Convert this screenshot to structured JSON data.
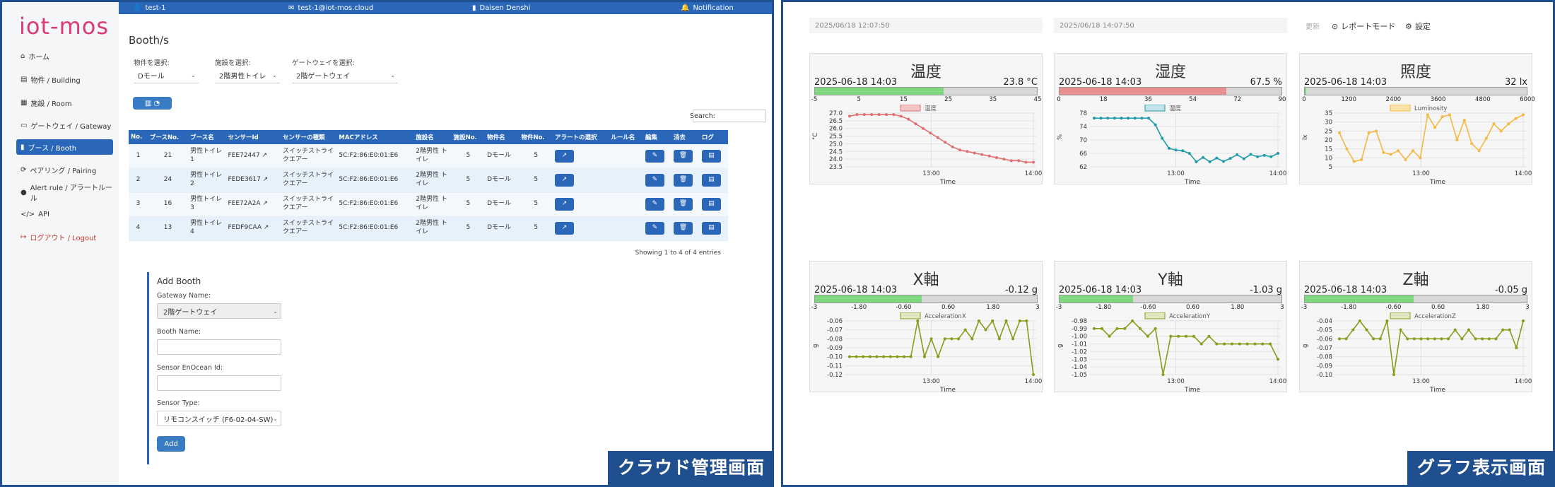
{
  "left_panel": {
    "caption": "クラウド管理画面",
    "logo": "iot-mos",
    "topbar": {
      "tenant": "test-1",
      "email": "test-1@iot-mos.cloud",
      "company": "Daisen Denshi",
      "notification": "Notification"
    },
    "nav": [
      {
        "icon": "home-icon",
        "glyph": "⌂",
        "label": "ホーム"
      },
      {
        "icon": "building-icon",
        "glyph": "▤",
        "label": "物件 / Building"
      },
      {
        "icon": "room-icon",
        "glyph": "▦",
        "label": "施設 / Room"
      },
      {
        "icon": "gateway-icon",
        "glyph": "▭",
        "label": "ゲートウェイ / Gateway"
      },
      {
        "icon": "booth-icon",
        "glyph": "▮",
        "label": "ブース / Booth"
      },
      {
        "icon": "pairing-icon",
        "glyph": "⟳",
        "label": "ペアリング / Pairing"
      },
      {
        "icon": "alert-icon",
        "glyph": "●",
        "label": "Alert rule / アラートルール"
      },
      {
        "icon": "code-icon",
        "glyph": "</>",
        "label": "API"
      },
      {
        "icon": "logout-icon",
        "glyph": "↦",
        "label": "ログアウト / Logout"
      }
    ],
    "active_nav": 4,
    "page_title": "Booth/s",
    "filters": [
      {
        "label": "物件を選択:",
        "value": "Dモール"
      },
      {
        "label": "施設を選択:",
        "value": "2階男性トイレ"
      },
      {
        "label": "ゲートウェイを選択:",
        "value": "2階ゲートウェイ"
      }
    ],
    "view_toggle_label": "▥ ◔",
    "search_label": "Search:",
    "columns": [
      "No.",
      "ブースNo.",
      "ブース名",
      "センサーId",
      "センサーの種類",
      "MACアドレス",
      "施設名",
      "施設No.",
      "物件名",
      "物件No.",
      "アラートの選択",
      "ルール名",
      "編集",
      "消去",
      "ログ"
    ],
    "rows": [
      {
        "no": "1",
        "booth_no": "21",
        "booth_name": "男性トイレ 1",
        "sensor_id": "FEE72447",
        "sensor_type": "スイッチストライクエアー",
        "mac": "5C:F2:86:E0:01:E6",
        "room": "2階男性 トイレ",
        "room_no": "5",
        "building": "Dモール",
        "building_no": "5",
        "rule": ""
      },
      {
        "no": "2",
        "booth_no": "24",
        "booth_name": "男性トイレ 2",
        "sensor_id": "FEDE3617",
        "sensor_type": "スイッチストライクエアー",
        "mac": "5C:F2:86:E0:01:E6",
        "room": "2階男性 トイレ",
        "room_no": "5",
        "building": "Dモール",
        "building_no": "5",
        "rule": ""
      },
      {
        "no": "3",
        "booth_no": "16",
        "booth_name": "男性トイレ 3",
        "sensor_id": "FEE72A2A",
        "sensor_type": "スイッチストライクエアー",
        "mac": "5C:F2:86:E0:01:E6",
        "room": "2階男性 トイレ",
        "room_no": "5",
        "building": "Dモール",
        "building_no": "5",
        "rule": ""
      },
      {
        "no": "4",
        "booth_no": "13",
        "booth_name": "男性トイレ 4",
        "sensor_id": "FEDF9CAA",
        "sensor_type": "スイッチストライクエアー",
        "mac": "5C:F2:86:E0:01:E6",
        "room": "2階男性 トイレ",
        "room_no": "5",
        "building": "Dモール",
        "building_no": "5",
        "rule": ""
      }
    ],
    "showing": "Showing 1 to 4 of 4 entries",
    "add_booth": {
      "title": "Add Booth",
      "gateway_label": "Gateway Name:",
      "gateway_value": "2階ゲートウェイ",
      "booth_label": "Booth Name:",
      "booth_value": "",
      "enocean_label": "Sensor EnOcean Id:",
      "enocean_value": "",
      "type_label": "Sensor Type:",
      "type_value": "リモコンスイッチ (F6-02-04-SW)",
      "add_button": "Add"
    }
  },
  "right_panel": {
    "caption": "グラフ表示画面",
    "start_date": "2025/06/18 12:07:50",
    "end_date": "2025/06/18 14:07:50",
    "update_label": "更新",
    "report_mode": "レポートモード",
    "settings": "設定",
    "x_axis_title": "Time",
    "colors": {
      "green": "#7fd87f",
      "red": "#e8908f",
      "temp_line": "#e07070",
      "hum_line": "#1f9aa8",
      "lux_line": "#f5b942",
      "acc_line": "#8a9a1a"
    },
    "cards": [
      {
        "title": "温度",
        "timestamp": "2025-06-18 14:03",
        "value": "23.8 °C",
        "level": 0.58,
        "bar_color": "#7fd87f",
        "gauge_ticks": [
          "-5",
          "5",
          "15",
          "25",
          "35",
          "45"
        ],
        "legend": "温度",
        "ylabel": "°C",
        "y_ticks": [
          "27.0",
          "26.5",
          "26.0",
          "25.5",
          "25.0",
          "24.5",
          "24.0",
          "23.5"
        ],
        "ymin": 23.5,
        "ymax": 27.0,
        "x_ticks": [
          "13:00",
          "14:00"
        ],
        "line_color": "#e07070",
        "legend_fill": "#f4c5c5",
        "series": [
          26.8,
          26.9,
          26.9,
          26.9,
          26.9,
          26.9,
          26.9,
          26.8,
          26.6,
          26.3,
          26.0,
          25.7,
          25.4,
          25.1,
          24.8,
          24.6,
          24.5,
          24.4,
          24.3,
          24.2,
          24.1,
          24.0,
          23.9,
          23.9,
          23.8,
          23.8
        ]
      },
      {
        "title": "湿度",
        "timestamp": "2025-06-18 14:03",
        "value": "67.5 %",
        "level": 0.75,
        "bar_color": "#e8908f",
        "gauge_ticks": [
          "0",
          "18",
          "36",
          "54",
          "72",
          "90"
        ],
        "legend": "湿度",
        "ylabel": "%",
        "y_ticks": [
          "78",
          "74",
          "70",
          "66",
          "62"
        ],
        "ymin": 62,
        "ymax": 78,
        "x_ticks": [
          "13:00",
          "14:00"
        ],
        "line_color": "#1f9aa8",
        "legend_fill": "#c5e5ea",
        "series": [
          76.5,
          76.5,
          76.5,
          76.5,
          76.5,
          76.5,
          76.5,
          76.5,
          76.5,
          74.5,
          70.5,
          67.5,
          67,
          66.8,
          66.0,
          63.5,
          64.8,
          63.5,
          64.6,
          63.6,
          64.5,
          65.6,
          64.4,
          65.7,
          65.0,
          65.4,
          65.0,
          66.0
        ]
      },
      {
        "title": "照度",
        "timestamp": "2025-06-18 14:03",
        "value": "32 lx",
        "level": 0.005,
        "bar_color": "#7fd87f",
        "gauge_ticks": [
          "0",
          "1200",
          "2400",
          "3600",
          "4800",
          "6000"
        ],
        "legend": "Luminosity",
        "ylabel": "lx",
        "y_ticks": [
          "35",
          "30",
          "25",
          "20",
          "15",
          "10",
          "5"
        ],
        "ymin": 5,
        "ymax": 35,
        "x_ticks": [
          "13:00",
          "14:00"
        ],
        "line_color": "#f5b942",
        "legend_fill": "#fbe2a8",
        "series": [
          24,
          15,
          8,
          9,
          24,
          25,
          13,
          12,
          14,
          9,
          14,
          10,
          34,
          27,
          33,
          34,
          20,
          31,
          18,
          14,
          21,
          29,
          25,
          29,
          32,
          34
        ]
      },
      {
        "title": "X軸",
        "timestamp": "2025-06-18 14:03",
        "value": "-0.12 g",
        "level": 0.48,
        "bar_color": "#7fd87f",
        "gauge_ticks": [
          "-3",
          "-1.80",
          "-0.60",
          "0.60",
          "1.80",
          "3"
        ],
        "legend": "AccelerationX",
        "ylabel": "g",
        "y_ticks": [
          "-0.06",
          "-0.07",
          "-0.08",
          "-0.09",
          "-0.10",
          "-0.11",
          "-0.12"
        ],
        "ymin": -0.12,
        "ymax": -0.06,
        "x_ticks": [
          "13:00",
          "14:00"
        ],
        "line_color": "#8a9a1a",
        "legend_fill": "#e2e6c3",
        "series": [
          -0.1,
          -0.1,
          -0.1,
          -0.1,
          -0.1,
          -0.1,
          -0.1,
          -0.1,
          -0.1,
          -0.1,
          -0.06,
          -0.1,
          -0.08,
          -0.1,
          -0.08,
          -0.08,
          -0.08,
          -0.07,
          -0.08,
          -0.06,
          -0.07,
          -0.06,
          -0.08,
          -0.06,
          -0.08,
          -0.06,
          -0.06,
          -0.12
        ]
      },
      {
        "title": "Y軸",
        "timestamp": "2025-06-18 14:03",
        "value": "-1.03 g",
        "level": 0.33,
        "bar_color": "#7fd87f",
        "gauge_ticks": [
          "-3",
          "-1.80",
          "-0.60",
          "0.60",
          "1.80",
          "3"
        ],
        "legend": "AccelerationY",
        "ylabel": "g",
        "y_ticks": [
          "-0.98",
          "-0.99",
          "-1.00",
          "-1.01",
          "-1.02",
          "-1.03",
          "-1.04",
          "-1.05"
        ],
        "ymin": -1.05,
        "ymax": -0.98,
        "x_ticks": [
          "13:00",
          "14:00"
        ],
        "line_color": "#8a9a1a",
        "legend_fill": "#e2e6c3",
        "series": [
          -0.99,
          -0.99,
          -1.0,
          -0.99,
          -0.99,
          -0.98,
          -0.99,
          -1.0,
          -0.99,
          -1.05,
          -1.0,
          -1.0,
          -1.0,
          -1.0,
          -1.01,
          -1.0,
          -1.01,
          -1.01,
          -1.01,
          -1.01,
          -1.01,
          -1.01,
          -1.01,
          -1.01,
          -1.03
        ]
      },
      {
        "title": "Z軸",
        "timestamp": "2025-06-18 14:03",
        "value": "-0.05 g",
        "level": 0.49,
        "bar_color": "#7fd87f",
        "gauge_ticks": [
          "-3",
          "-1.80",
          "-0.60",
          "0.60",
          "1.80",
          "3"
        ],
        "legend": "AccelerationZ",
        "ylabel": "g",
        "y_ticks": [
          "-0.04",
          "-0.05",
          "-0.06",
          "-0.07",
          "-0.08",
          "-0.09",
          "-0.10"
        ],
        "ymin": -0.1,
        "ymax": -0.04,
        "x_ticks": [
          "13:00",
          "14:00"
        ],
        "line_color": "#8a9a1a",
        "legend_fill": "#e2e6c3",
        "series": [
          -0.06,
          -0.06,
          -0.05,
          -0.04,
          -0.05,
          -0.06,
          -0.06,
          -0.04,
          -0.1,
          -0.05,
          -0.06,
          -0.06,
          -0.06,
          -0.06,
          -0.06,
          -0.06,
          -0.06,
          -0.05,
          -0.06,
          -0.05,
          -0.06,
          -0.06,
          -0.06,
          -0.06,
          -0.05,
          -0.05,
          -0.07,
          -0.04
        ]
      }
    ]
  }
}
